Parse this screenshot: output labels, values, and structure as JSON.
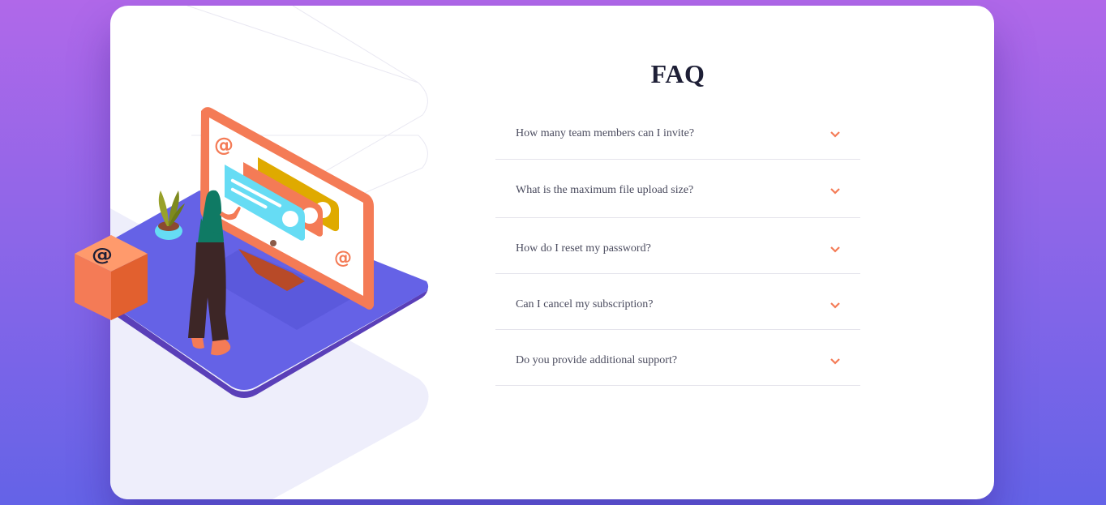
{
  "faq": {
    "title": "FAQ",
    "items": [
      {
        "question": "How many team members can I invite?"
      },
      {
        "question": "What is the maximum file upload size?"
      },
      {
        "question": "How do I reset my password?"
      },
      {
        "question": "Can I cancel my subscription?"
      },
      {
        "question": "Do you provide additional support?"
      }
    ]
  },
  "colors": {
    "accent": "#f47b56",
    "title": "#1e1f36",
    "text": "#4a4b5e",
    "divider": "#e5e4ec",
    "bg_top": "#b068e9",
    "bg_bottom": "#6463e7"
  },
  "icons": {
    "expand": "chevron-down-icon",
    "cube": "at-sign-icon"
  }
}
